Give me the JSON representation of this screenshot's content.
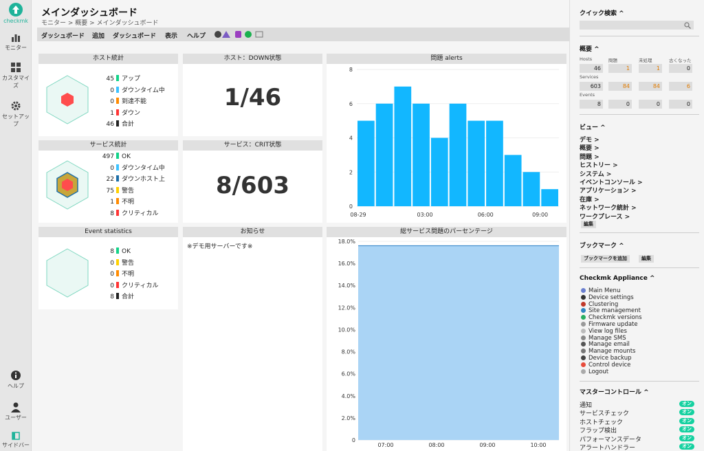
{
  "nav": {
    "logo_text": "checkmk",
    "items": [
      {
        "label": "モニター",
        "icon": "bar-chart-icon"
      },
      {
        "label": "カスタマイズ",
        "icon": "grid-icon"
      },
      {
        "label": "セットアップ",
        "icon": "gear-icon"
      },
      {
        "label": "ヘルプ",
        "icon": "info-icon"
      },
      {
        "label": "ユーザー",
        "icon": "user-icon"
      },
      {
        "label": "サイドバー",
        "icon": "sidebar-icon"
      }
    ]
  },
  "page": {
    "title": "メインダッシュボード",
    "breadcrumb": "モニター > 概要 > メインダッシュボード"
  },
  "menu": [
    "ダッシュボード",
    "追加",
    "ダッシュボード",
    "表示",
    "ヘルプ"
  ],
  "dashlets": {
    "host_stats": {
      "title": "ホスト統計",
      "rows": [
        {
          "n": "45",
          "label": "アップ",
          "color": "#13d389"
        },
        {
          "n": "0",
          "label": "ダウンタイム中",
          "color": "#3cc2ff"
        },
        {
          "n": "0",
          "label": "到達不能",
          "color": "#ff8b00"
        },
        {
          "n": "1",
          "label": "ダウン",
          "color": "#ff3434"
        },
        {
          "n": "46",
          "label": "合計",
          "color": "#222222"
        }
      ]
    },
    "host_down": {
      "title": "ホスト：DOWN状態",
      "value": "1/46"
    },
    "alerts": {
      "title": "問題 alerts"
    },
    "service_stats": {
      "title": "サービス統計",
      "rows": [
        {
          "n": "497",
          "label": "OK",
          "color": "#13d389"
        },
        {
          "n": "0",
          "label": "ダウンタイム中",
          "color": "#3cc2ff"
        },
        {
          "n": "22",
          "label": "ダウンホスト上",
          "color": "#1d6fa8"
        },
        {
          "n": "75",
          "label": "警告",
          "color": "#ffd000"
        },
        {
          "n": "1",
          "label": "不明",
          "color": "#ff8b00"
        },
        {
          "n": "8",
          "label": "クリティカル",
          "color": "#ff3434"
        }
      ]
    },
    "service_crit": {
      "title": "サービス：CRIT状態",
      "value": "8/603"
    },
    "event_stats": {
      "title": "Event statistics",
      "rows": [
        {
          "n": "8",
          "label": "OK",
          "color": "#13d389"
        },
        {
          "n": "0",
          "label": "警告",
          "color": "#ffd000"
        },
        {
          "n": "0",
          "label": "不明",
          "color": "#ff8b00"
        },
        {
          "n": "0",
          "label": "クリティカル",
          "color": "#ff3434"
        },
        {
          "n": "8",
          "label": "合計",
          "color": "#222222"
        }
      ]
    },
    "notice": {
      "title": "お知らせ",
      "text": "※デモ用サーバーです※"
    },
    "percent": {
      "title": "総サービス問題のパーセンテージ"
    }
  },
  "chart_data": [
    {
      "type": "bar",
      "title": "問題 alerts",
      "x_tick_labels": [
        "08-29",
        "03:00",
        "06:00",
        "09:00"
      ],
      "values": [
        5,
        6,
        7,
        6,
        4,
        6,
        5,
        5,
        3,
        2,
        1
      ],
      "ylim": [
        0,
        8
      ],
      "yticks": [
        0,
        2,
        4,
        6,
        8
      ],
      "color": "#12b7ff"
    },
    {
      "type": "area",
      "title": "総サービス問題のパーセンテージ",
      "x_tick_labels": [
        "07:00",
        "08:00",
        "09:00",
        "10:00"
      ],
      "values": [
        17.6,
        17.6,
        17.6,
        17.6,
        17.6,
        17.6,
        17.6,
        17.6,
        17.6,
        17.6,
        17.6
      ],
      "ylim": [
        0,
        18
      ],
      "yticks": [
        "0",
        "2.0%",
        "4.0%",
        "6.0%",
        "8.0%",
        "10.0%",
        "12.0%",
        "14.0%",
        "16.0%",
        "18.0%"
      ],
      "color": "#aad4f5"
    }
  ],
  "sidebar": {
    "quick_search": "クイック検索 ^",
    "overview": {
      "title": "概要 ^",
      "col_headers": [
        "問題",
        "未処理",
        "古くなった"
      ],
      "rows": [
        {
          "label": "Hosts",
          "total": "46",
          "problems": "1",
          "unhandled": "1",
          "stale": "0"
        },
        {
          "label": "Services",
          "total": "603",
          "problems": "84",
          "unhandled": "84",
          "stale": "6"
        },
        {
          "label": "Events",
          "total": "8",
          "problems": "0",
          "unhandled": "0",
          "stale": "0"
        }
      ]
    },
    "views": {
      "title": "ビュー ^",
      "items": [
        "デモ >",
        "概要 >",
        "問題 >",
        "ヒストリー >",
        "システム >",
        "イベントコンソール >",
        "アプリケーション >",
        "在庫 >",
        "ネットワーク統計 >",
        "ワークプレース >"
      ],
      "edit": "編集"
    },
    "bookmarks": {
      "title": "ブックマーク ^",
      "add": "ブックマークを追加",
      "edit": "編集"
    },
    "appliance": {
      "title": "Checkmk Appliance ^",
      "items": [
        {
          "label": "Main Menu",
          "color": "#6a7fcf"
        },
        {
          "label": "Device settings",
          "color": "#333333"
        },
        {
          "label": "Clustering",
          "color": "#c0392b"
        },
        {
          "label": "Site management",
          "color": "#2e86c1"
        },
        {
          "label": "Checkmk versions",
          "color": "#27ae60"
        },
        {
          "label": "Firmware update",
          "color": "#999999"
        },
        {
          "label": "View log files",
          "color": "#bbbbbb"
        },
        {
          "label": "Manage SMS",
          "color": "#888888"
        },
        {
          "label": "Manage email",
          "color": "#555555"
        },
        {
          "label": "Manage mounts",
          "color": "#777777"
        },
        {
          "label": "Device backup",
          "color": "#444444"
        },
        {
          "label": "Control device",
          "color": "#e74c3c"
        },
        {
          "label": "Logout",
          "color": "#aaaaaa"
        }
      ]
    },
    "master": {
      "title": "マスターコントロール ^",
      "items": [
        "通知",
        "サービスチェック",
        "ホストチェック",
        "フラップ検出",
        "パフォーマンスデータ",
        "アラートハンドラー"
      ],
      "state": "オン"
    }
  }
}
